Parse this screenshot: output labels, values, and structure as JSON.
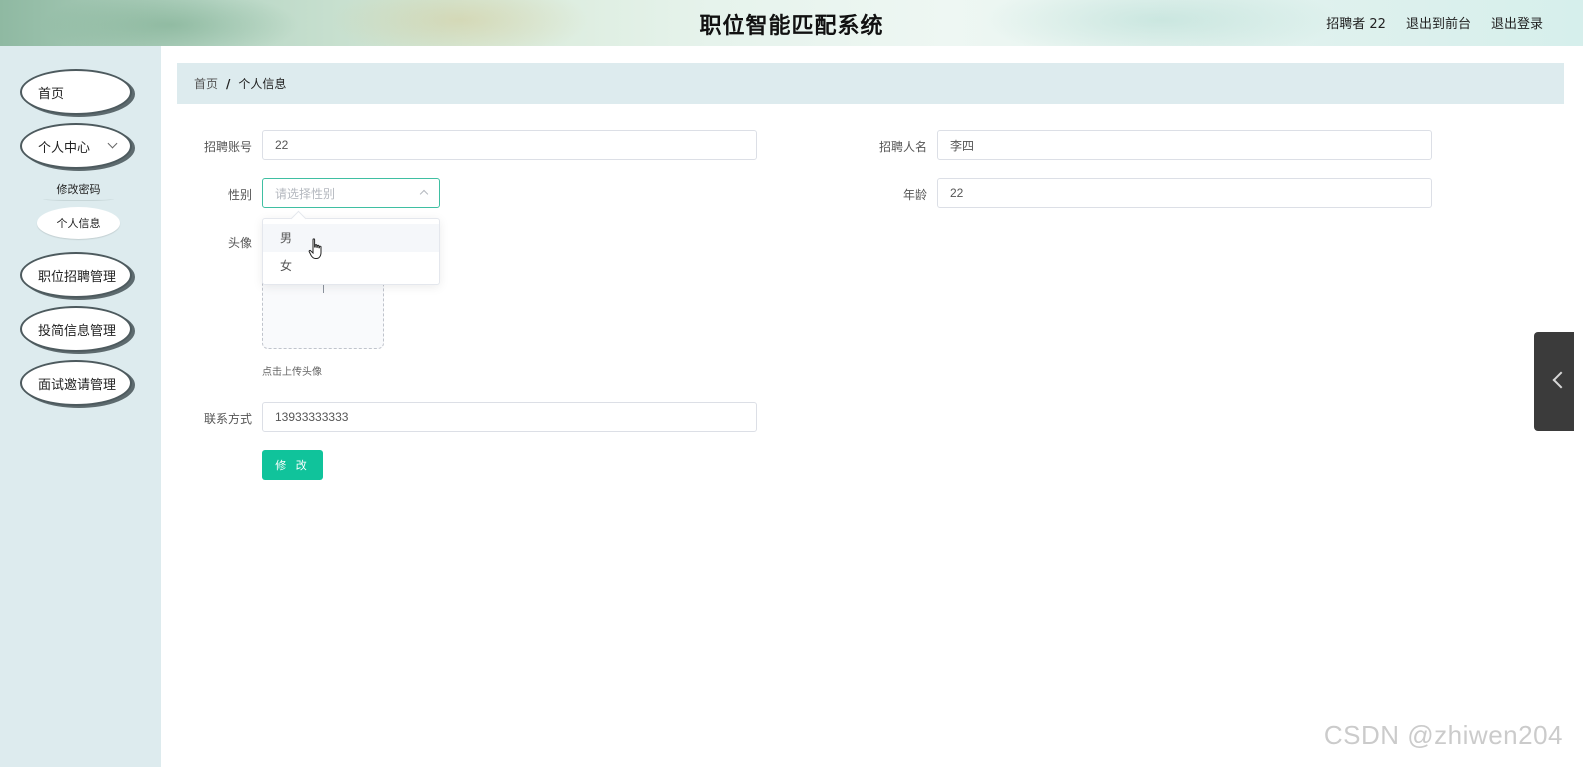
{
  "header": {
    "title": "职位智能匹配系统",
    "user_label": "招聘者 22",
    "to_front_label": "退出到前台",
    "logout_label": "退出登录"
  },
  "sidebar": {
    "items": [
      {
        "label": "首页"
      },
      {
        "label": "个人中心",
        "expanded": true,
        "children": [
          {
            "label": "修改密码"
          },
          {
            "label": "个人信息",
            "active": true
          }
        ]
      },
      {
        "label": "职位招聘管理"
      },
      {
        "label": "投简信息管理"
      },
      {
        "label": "面试邀请管理"
      }
    ]
  },
  "breadcrumb": {
    "home": "首页",
    "separator": "/",
    "current": "个人信息"
  },
  "form": {
    "account": {
      "label": "招聘账号",
      "value": "22"
    },
    "name": {
      "label": "招聘人名",
      "value": "李四"
    },
    "gender": {
      "label": "性别",
      "placeholder": "请选择性别",
      "options": [
        "男",
        "女"
      ],
      "open": true
    },
    "age": {
      "label": "年龄",
      "value": "22"
    },
    "avatar": {
      "label": "头像",
      "hint": "点击上传头像"
    },
    "phone": {
      "label": "联系方式",
      "value": "13933333333"
    },
    "submit_label": "修 改"
  },
  "colors": {
    "accent": "#10c39b",
    "select_focus": "#3fbfa2",
    "sidebar_bg": "#ddebee"
  },
  "watermark": "CSDN @zhiwen204"
}
